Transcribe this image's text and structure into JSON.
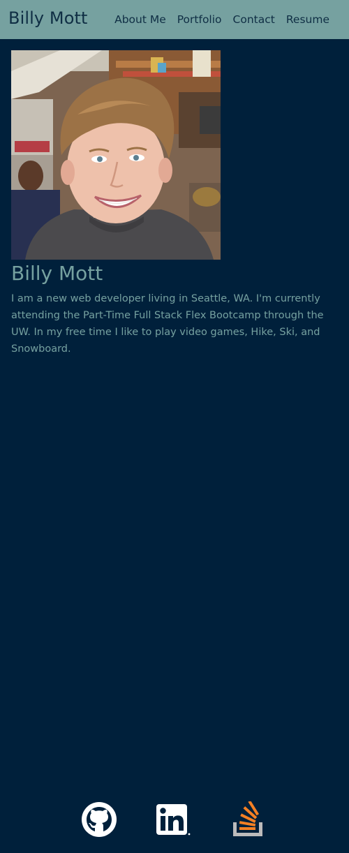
{
  "header": {
    "brand": "Billy Mott",
    "nav": [
      {
        "label": "About Me"
      },
      {
        "label": "Portfolio"
      },
      {
        "label": "Contact"
      },
      {
        "label": "Resume"
      }
    ]
  },
  "profile": {
    "photo_icon": "profile-photo",
    "name": "Billy Mott",
    "bio": "I am a new web developer living in Seattle, WA. I'm currently attending the Part-Time Full Stack Flex Bootcamp through the UW. In my free time I like to play video games, Hike, Ski, and Snowboard."
  },
  "footer": {
    "social_icons": [
      "github-icon",
      "linkedin-icon",
      "stackoverflow-icon"
    ]
  },
  "colors": {
    "navbar": "#76a1a0",
    "background": "#00203b",
    "text": "#76a1a0",
    "stackoverflow_orange": "#f48024"
  }
}
